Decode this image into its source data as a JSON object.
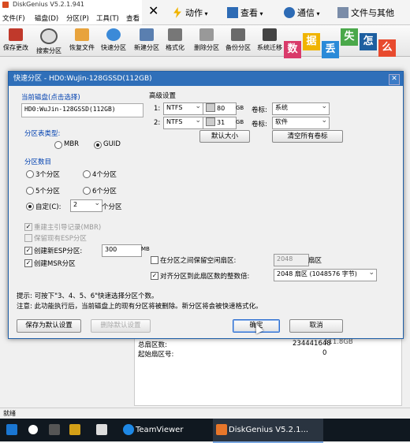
{
  "window": {
    "title": "DiskGenius V5.2.1.941"
  },
  "menu": [
    "文件(F)",
    "磁盘(D)",
    "分区(P)",
    "工具(T)",
    "查看"
  ],
  "toolbar": [
    "保存更改",
    "搜索分区",
    "恢复文件",
    "快速分区",
    "新建分区",
    "格式化",
    "删除分区",
    "备份分区",
    "系统迁移"
  ],
  "overlay": {
    "action": "动作",
    "view": "查看",
    "comm": "通信",
    "files": "文件与其他"
  },
  "sticker": [
    "数",
    "据",
    "丢",
    "失",
    "怎",
    "么"
  ],
  "dialog": {
    "title": "快速分区 - HD0:WuJin-128GSSD(112GB)",
    "current_disk_label": "当前磁盘(点击选择)",
    "current_disk_value": "HD0:WuJin-128GSSD(112GB)",
    "table_type_label": "分区表类型:",
    "mbr": "MBR",
    "guid": "GUID",
    "count_label": "分区数目",
    "opt3": "3个分区",
    "opt4": "4个分区",
    "opt5": "5个分区",
    "opt6": "6个分区",
    "custom": "自定(C):",
    "custom_value": "2",
    "custom_unit": "个分区",
    "rebuild_mbr": "重建主引导记录(MBR)",
    "keep_esp": "保留现有ESP分区",
    "create_esp": "创建新ESP分区:",
    "esp_size": "300",
    "esp_unit": "MB",
    "create_msr": "创建MSR分区",
    "advanced_label": "高级设置",
    "rows": [
      {
        "index": "1:",
        "fs": "NTFS",
        "size": "80",
        "unit": "GB",
        "vol_label": "卷标:",
        "vol": "系统"
      },
      {
        "index": "2:",
        "fs": "NTFS",
        "size": "31",
        "unit": "GB",
        "vol_label": "卷标:",
        "vol": "软件"
      }
    ],
    "default_size_btn": "默认大小",
    "clear_labels_btn": "清空所有卷标",
    "reserve_label": "在分区之间保留空闲扇区:",
    "reserve_value": "2048",
    "reserve_unit": "扇区",
    "align_label": "对齐分区到此扇区数的整数倍:",
    "align_value": "2048 扇区 (1048576 字节)",
    "tip_line": "提示: 可按下\"3、4、5、6\"快速选择分区个数。",
    "warn_line": "注意: 此功能执行后，当前磁盘上的现有分区将被删除。新分区将会被快速格式化。",
    "save_default_btn": "保存为默认设置",
    "reset_default_btn": "删除默认设置",
    "ok_btn": "确定",
    "cancel_btn": "取消"
  },
  "background_panel": {
    "r1_label": "总扇区数:",
    "r1_value": "234441648",
    "r2_label": "起始扇区号:",
    "r2_value": "0",
    "r0_value": "111.8GB"
  },
  "status": "就绪",
  "taskbar": {
    "teamviewer": "TeamViewer",
    "diskgenius": "DiskGenius V5.2.1..."
  }
}
